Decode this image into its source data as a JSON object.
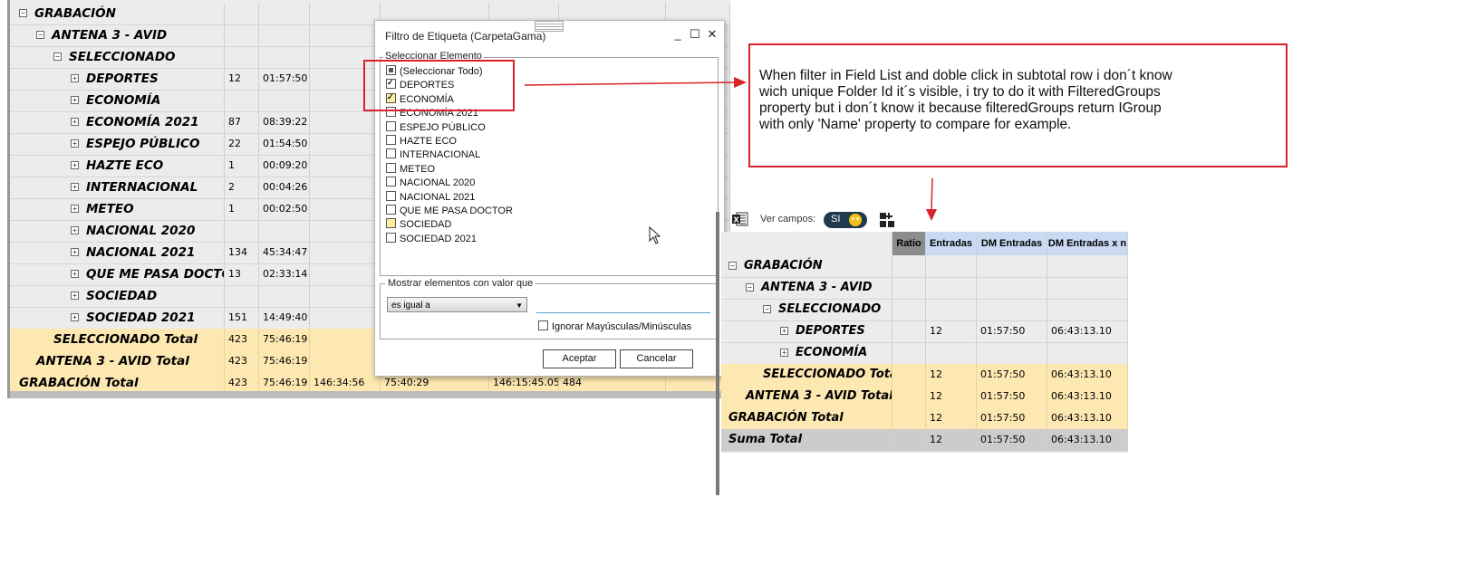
{
  "left_grid": {
    "rows": [
      {
        "label": "GRABACIÓN",
        "indent": 0,
        "expander": "⊟",
        "type": "group",
        "values": []
      },
      {
        "label": "ANTENA 3 - AVID",
        "indent": 1,
        "expander": "⊟",
        "type": "group",
        "values": []
      },
      {
        "label": "SELECCIONADO",
        "indent": 2,
        "expander": "⊟",
        "type": "group",
        "values": []
      },
      {
        "label": "DEPORTES",
        "indent": 3,
        "expander": "⊞",
        "type": "item",
        "values": [
          "12",
          "01:57:50"
        ]
      },
      {
        "label": "ECONOMÍA",
        "indent": 3,
        "expander": "⊞",
        "type": "item",
        "values": [
          "",
          ""
        ]
      },
      {
        "label": "ECONOMÍA 2021",
        "indent": 3,
        "expander": "⊞",
        "type": "item",
        "values": [
          "87",
          "08:39:22"
        ]
      },
      {
        "label": "ESPEJO PÚBLICO",
        "indent": 3,
        "expander": "⊞",
        "type": "item",
        "values": [
          "22",
          "01:54:50"
        ]
      },
      {
        "label": "HAZTE ECO",
        "indent": 3,
        "expander": "⊞",
        "type": "item",
        "values": [
          "1",
          "00:09:20"
        ]
      },
      {
        "label": "INTERNACIONAL",
        "indent": 3,
        "expander": "⊞",
        "type": "item",
        "values": [
          "2",
          "00:04:26"
        ]
      },
      {
        "label": "METEO",
        "indent": 3,
        "expander": "⊞",
        "type": "item",
        "values": [
          "1",
          "00:02:50"
        ]
      },
      {
        "label": "NACIONAL 2020",
        "indent": 3,
        "expander": "⊞",
        "type": "item",
        "values": [
          "",
          ""
        ]
      },
      {
        "label": "NACIONAL 2021",
        "indent": 3,
        "expander": "⊞",
        "type": "item",
        "values": [
          "134",
          "45:34:47"
        ]
      },
      {
        "label": "QUE ME PASA DOCTOR",
        "indent": 3,
        "expander": "⊞",
        "type": "item",
        "values": [
          "13",
          "02:33:14"
        ]
      },
      {
        "label": "SOCIEDAD",
        "indent": 3,
        "expander": "⊞",
        "type": "item",
        "values": [
          "",
          ""
        ]
      },
      {
        "label": "SOCIEDAD 2021",
        "indent": 3,
        "expander": "⊞",
        "type": "item",
        "values": [
          "151",
          "14:49:40"
        ]
      },
      {
        "label": "SELECCIONADO Total",
        "indent": 2,
        "expander": "",
        "type": "total",
        "values": [
          "423",
          "75:46:19"
        ]
      },
      {
        "label": "ANTENA 3 - AVID Total",
        "indent": 1,
        "expander": "",
        "type": "total",
        "values": [
          "423",
          "75:46:19"
        ]
      },
      {
        "label": "GRABACIÓN Total",
        "indent": 0,
        "expander": "",
        "type": "total",
        "values": [
          "423",
          "75:46:19",
          "146:34:56",
          "75:40:29",
          "146:15:45.05",
          "484"
        ]
      }
    ]
  },
  "filter_dialog": {
    "title": "Filtro de Etiqueta (CarpetaGama)",
    "minimize": "_",
    "maximize": "☐",
    "close": "✕",
    "select_group_label": "Seleccionar Elemento",
    "items": [
      {
        "label": "(Seleccionar Todo)",
        "state": "partial"
      },
      {
        "label": "DEPORTES",
        "state": "checked"
      },
      {
        "label": "ECONOMÍA",
        "state": "checked-hl"
      },
      {
        "label": "ECONOMÍA 2021",
        "state": "unchecked"
      },
      {
        "label": "ESPEJO PÚBLICO",
        "state": "unchecked"
      },
      {
        "label": "HAZTE ECO",
        "state": "unchecked"
      },
      {
        "label": "INTERNACIONAL",
        "state": "unchecked"
      },
      {
        "label": "METEO",
        "state": "unchecked"
      },
      {
        "label": "NACIONAL 2020",
        "state": "unchecked"
      },
      {
        "label": "NACIONAL 2021",
        "state": "unchecked"
      },
      {
        "label": "QUE ME PASA DOCTOR",
        "state": "unchecked"
      },
      {
        "label": "SOCIEDAD",
        "state": "hl"
      },
      {
        "label": "SOCIEDAD 2021",
        "state": "unchecked"
      }
    ],
    "show_group_label": "Mostrar elementos con valor que",
    "condition_value": "es igual a",
    "condition_input": "",
    "ignore_case_label": "Ignorar Mayúsculas/Minúsculas",
    "accept_label": "Aceptar",
    "cancel_label": "Cancelar"
  },
  "annotation": {
    "lines": [
      "When filter in Field List and doble click in subtotal row i  don´t know",
      "wich unique Folder Id it´s visible, i try to do it with FilteredGroups",
      "property but i don´t know it because filteredGroups return IGroup",
      "with only 'Name' property to compare for example."
    ],
    "border_color": "#d8232a"
  },
  "right_panel": {
    "toolbar": {
      "excel_icon": "excel-icon",
      "ver_campos_label": "Ver campos:",
      "toggle_label": "SI",
      "toggle_knob": "••",
      "fields_icon": "field-list-icon"
    },
    "headers": [
      "Ratio",
      "Entradas",
      "DM Entradas",
      "DM Entradas x n"
    ],
    "rows": [
      {
        "label": "GRABACIÓN",
        "indent": 0,
        "expander": "⊟",
        "type": "group",
        "values": [
          "",
          "",
          "",
          ""
        ]
      },
      {
        "label": "ANTENA 3 - AVID",
        "indent": 1,
        "expander": "⊟",
        "type": "group",
        "values": [
          "",
          "",
          "",
          ""
        ]
      },
      {
        "label": "SELECCIONADO",
        "indent": 2,
        "expander": "⊟",
        "type": "group",
        "values": [
          "",
          "",
          "",
          ""
        ]
      },
      {
        "label": "DEPORTES",
        "indent": 3,
        "expander": "⊞",
        "type": "item",
        "values": [
          "",
          "12",
          "01:57:50",
          "06:43:13.10"
        ]
      },
      {
        "label": "ECONOMÍA",
        "indent": 3,
        "expander": "⊞",
        "type": "item",
        "values": [
          "",
          "",
          "",
          ""
        ]
      },
      {
        "label": "SELECCIONADO Total",
        "indent": 2,
        "expander": "",
        "type": "total",
        "values": [
          "",
          "12",
          "01:57:50",
          "06:43:13.10"
        ]
      },
      {
        "label": "ANTENA 3 - AVID Total",
        "indent": 1,
        "expander": "",
        "type": "total",
        "values": [
          "",
          "12",
          "01:57:50",
          "06:43:13.10"
        ]
      },
      {
        "label": "GRABACIÓN Total",
        "indent": 0,
        "expander": "",
        "type": "total",
        "values": [
          "",
          "12",
          "01:57:50",
          "06:43:13.10"
        ]
      },
      {
        "label": "Suma Total",
        "indent": 0,
        "expander": "",
        "type": "grand",
        "values": [
          "",
          "12",
          "01:57:50",
          "06:43:13.10"
        ]
      }
    ]
  },
  "colors": {
    "total_row": "#fde8b2",
    "grand_total_row": "#cccccc",
    "header_bg": "#c9d9f2",
    "ratio_header_bg": "#8c8c8c",
    "annotation_red": "#d8232a"
  }
}
